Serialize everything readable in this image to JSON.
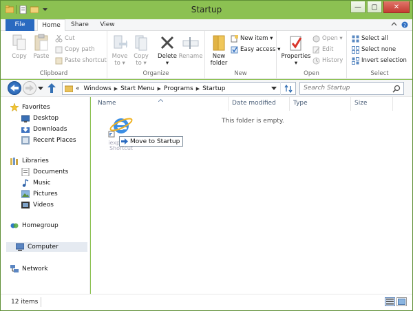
{
  "window": {
    "title": "Startup"
  },
  "titlebar_controls": {
    "minimize": "—",
    "maximize": "▢",
    "close": "✕"
  },
  "tabs": {
    "file": "File",
    "home": "Home",
    "share": "Share",
    "view": "View"
  },
  "ribbon": {
    "clipboard": {
      "label": "Clipboard",
      "copy": "Copy",
      "paste": "Paste",
      "cut": "Cut",
      "copy_path": "Copy path",
      "paste_shortcut": "Paste shortcut"
    },
    "organize": {
      "label": "Organize",
      "move_to_1": "Move",
      "move_to_2": "to ▾",
      "copy_to_1": "Copy",
      "copy_to_2": "to ▾",
      "delete": "Delete",
      "delete_arrow": "▾",
      "rename": "Rename"
    },
    "new": {
      "label": "New",
      "new_folder_1": "New",
      "new_folder_2": "folder",
      "new_item": "New item ▾",
      "easy_access": "Easy access ▾"
    },
    "open": {
      "label": "Open",
      "properties": "Properties",
      "properties_arrow": "▾",
      "open": "Open ▾",
      "edit": "Edit",
      "history": "History"
    },
    "select": {
      "label": "Select",
      "select_all": "Select all",
      "select_none": "Select none",
      "invert_selection": "Invert selection"
    }
  },
  "address": {
    "breadcrumb": [
      "Windows",
      "Start Menu",
      "Programs",
      "Startup"
    ],
    "overflow": "«",
    "search_placeholder": "Search Startup"
  },
  "nav": {
    "favorites": "Favorites",
    "desktop": "Desktop",
    "downloads": "Downloads",
    "recent_places": "Recent Places",
    "libraries": "Libraries",
    "documents": "Documents",
    "music": "Music",
    "pictures": "Pictures",
    "videos": "Videos",
    "homegroup": "Homegroup",
    "computer": "Computer",
    "network": "Network"
  },
  "content": {
    "columns": {
      "name": "Name",
      "date_modified": "Date modified",
      "type": "Type",
      "size": "Size"
    },
    "empty_message": "This folder is empty.",
    "drag_item_label_1": "iexplore -",
    "drag_item_label_2": "Shortcut",
    "drag_tooltip": "Move to Startup"
  },
  "status": {
    "item_count": "12 items"
  },
  "colors": {
    "frame": "#8cc152",
    "file_tab": "#2a6ac0",
    "accent": "#3470b4"
  }
}
